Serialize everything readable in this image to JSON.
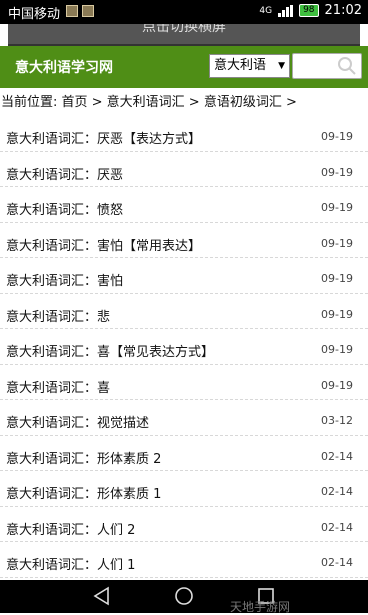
{
  "status_bar": {
    "carrier": "中国移动",
    "network": "4G",
    "battery": "98",
    "time": "21:02"
  },
  "banner_text": "点击切换横屏",
  "header": {
    "site_title": "意大利语学习网",
    "language_select": "意大利语",
    "search_placeholder": ""
  },
  "breadcrumb": "当前位置: 首页 > 意大利语词汇 > 意语初级词汇 >",
  "articles": [
    {
      "title": "意大利语词汇：厌恶【表达方式】",
      "date": "09-19"
    },
    {
      "title": "意大利语词汇：厌恶",
      "date": "09-19"
    },
    {
      "title": "意大利语词汇：愤怒",
      "date": "09-19"
    },
    {
      "title": "意大利语词汇：害怕【常用表达】",
      "date": "09-19"
    },
    {
      "title": "意大利语词汇：害怕",
      "date": "09-19"
    },
    {
      "title": "意大利语词汇：悲",
      "date": "09-19"
    },
    {
      "title": "意大利语词汇：喜【常见表达方式】",
      "date": "09-19"
    },
    {
      "title": "意大利语词汇：喜",
      "date": "09-19"
    },
    {
      "title": "意大利语词汇：视觉描述",
      "date": "03-12"
    },
    {
      "title": "意大利语词汇：形体素质 2",
      "date": "02-14"
    },
    {
      "title": "意大利语词汇：形体素质 1",
      "date": "02-14"
    },
    {
      "title": "意大利语词汇：人们 2",
      "date": "02-14"
    },
    {
      "title": "意大利语词汇：人们 1",
      "date": "02-14"
    }
  ],
  "watermark": "天地手游网",
  "colors": {
    "header_bg": "#4f8e16",
    "status_bar_bg": "#000000"
  }
}
